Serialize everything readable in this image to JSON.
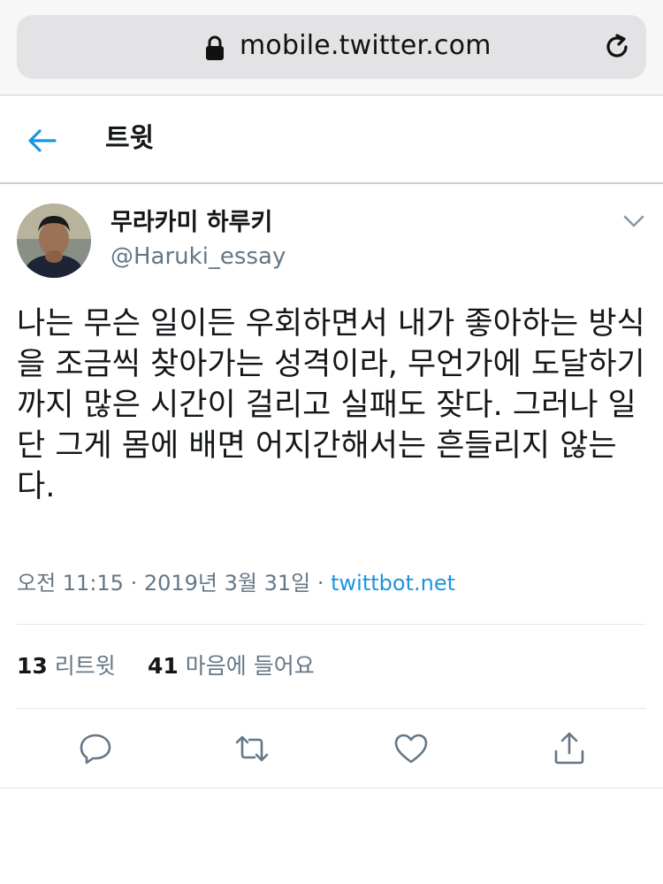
{
  "browser": {
    "url": "mobile.twitter.com",
    "lock_icon": "lock-icon",
    "reload_icon": "reload-icon"
  },
  "header": {
    "back_icon": "arrow-left-icon",
    "title": "트윗"
  },
  "tweet": {
    "display_name": "무라카미 하루키",
    "handle": "@Haruki_essay",
    "text": "나는 무슨 일이든 우회하면서 내가 좋아하는 방식을 조금씩 찾아가는 성격이라, 무언가에 도달하기까지 많은 시간이 걸리고 실패도 잦다. 그러나 일단 그게 몸에 배면 어지간해서는 흔들리지 않는다.",
    "time": "오전 11:15",
    "date": "2019년 3월 31일",
    "separator": " · ",
    "source": "twittbot.net"
  },
  "stats": {
    "retweets_count": "13",
    "retweets_label": "리트윗",
    "likes_count": "41",
    "likes_label": "마음에 들어요"
  },
  "actions": [
    "reply-icon",
    "retweet-icon",
    "heart-icon",
    "share-icon"
  ],
  "colors": {
    "accent": "#1b95e0",
    "text": "#14171a",
    "secondary_text": "#657786",
    "divider": "#e1e8ed",
    "url_field": "#e3e3e6"
  }
}
